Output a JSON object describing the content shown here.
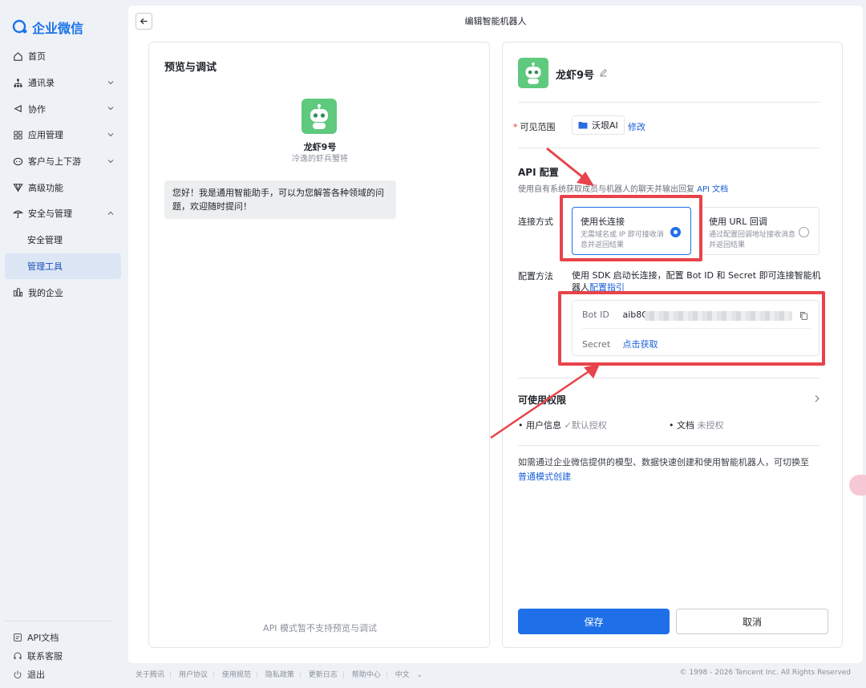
{
  "app": {
    "logo_text": "企业微信"
  },
  "sidebar": {
    "items": [
      {
        "label": "首页",
        "icon": "home-icon"
      },
      {
        "label": "通讯录",
        "icon": "org-icon"
      },
      {
        "label": "协作",
        "icon": "collab-icon"
      },
      {
        "label": "应用管理",
        "icon": "apps-icon"
      },
      {
        "label": "客户与上下游",
        "icon": "customer-icon"
      },
      {
        "label": "高级功能",
        "icon": "advanced-icon"
      },
      {
        "label": "安全与管理",
        "icon": "security-icon"
      },
      {
        "label": "安全管理"
      },
      {
        "label": "管理工具"
      },
      {
        "label": "我的企业",
        "icon": "company-icon"
      }
    ],
    "bottom": [
      {
        "label": "API文档",
        "icon": "doc-icon"
      },
      {
        "label": "联系客服",
        "icon": "headset-icon"
      },
      {
        "label": "退出",
        "icon": "power-icon"
      }
    ]
  },
  "header": {
    "title": "编辑智能机器人"
  },
  "preview": {
    "title": "预览与调试",
    "bot_name": "龙虾9号",
    "bot_sub": "冷逸的虾兵蟹将",
    "greeting": "您好！我是通用智能助手，可以为您解答各种领域的问题，欢迎随时提问！",
    "footer": "API 模式暂不支持预览与调试"
  },
  "config": {
    "bot_name": "龙虾9号",
    "scope_label": "可见范围",
    "scope_value": "沃垠AI",
    "scope_edit": "修改",
    "api_title": "API 配置",
    "api_desc": "使用自有系统获取成员与机器人的聊天并输出回复",
    "api_doc_link": "API 文档",
    "conn_label": "连接方式",
    "conn_long_title": "使用长连接",
    "conn_long_desc": "无需域名或 IP 即可接收消息并返回结果",
    "conn_url_title": "使用 URL 回调",
    "conn_url_desc": "通过配置回调地址接收消息并返回结果",
    "method_label": "配置方法",
    "method_text": "使用 SDK 启动长连接，配置 Bot ID 和 Secret 即可连接智能机器人",
    "method_link": "配置指引",
    "bot_id_label": "Bot ID",
    "bot_id_value": "aib8Qk",
    "secret_label": "Secret",
    "secret_link": "点击获取",
    "perm_title": "可使用权限",
    "perm_user": "用户信息",
    "perm_user_status": "默认授权",
    "perm_doc": "文档",
    "perm_doc_status": "未授权",
    "note_text": "如需通过企业微信提供的模型、数据快速创建和使用智能机器人，可切换至",
    "note_link": "普通模式创建",
    "save": "保存",
    "cancel": "取消"
  },
  "footer": {
    "links": [
      "关于腾讯",
      "用户协议",
      "使用规范",
      "隐私政策",
      "更新日志",
      "帮助中心",
      "中文"
    ],
    "copyright": "© 1998 - 2026 Tencent Inc. All Rights Reserved"
  },
  "colors": {
    "accent": "#1f70e8",
    "highlight": "#e8434a",
    "bot_green": "#5fc97e"
  }
}
